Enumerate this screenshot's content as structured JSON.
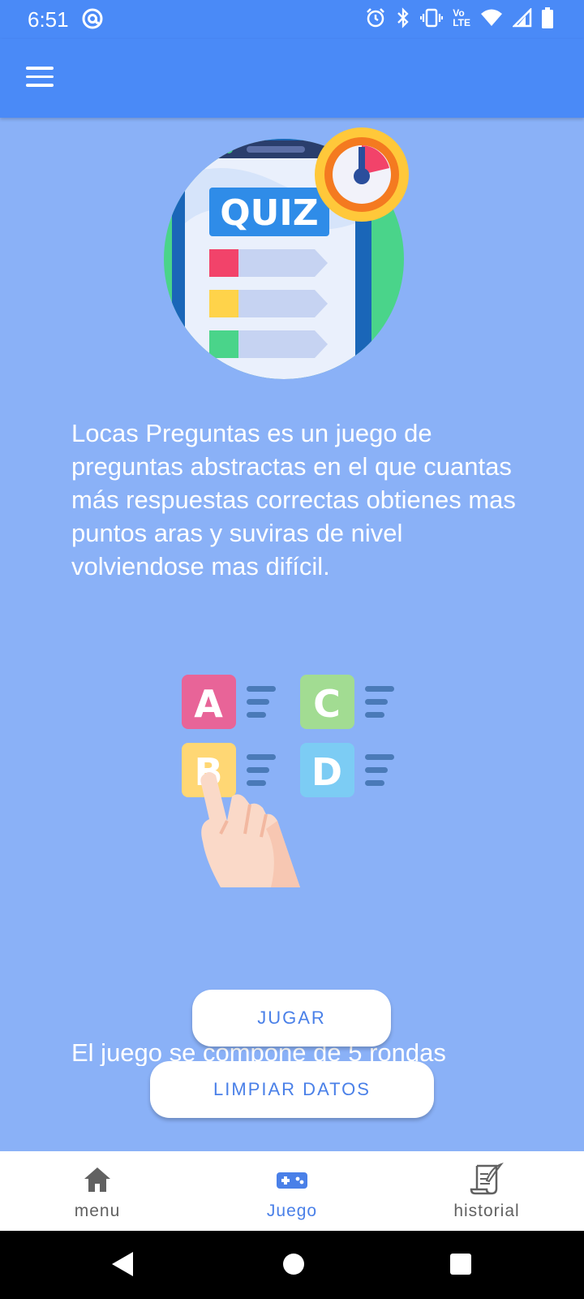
{
  "status_bar": {
    "time": "6:51",
    "icons": [
      "at-sign-icon",
      "alarm-icon",
      "bluetooth-icon",
      "vibrate-icon",
      "volte-icon",
      "wifi-icon",
      "signal-icon",
      "battery-icon"
    ],
    "volte_label_top": "Vo",
    "volte_label_bottom": "LTE"
  },
  "app_bar": {
    "menu_icon": "menu-icon",
    "color": "#4A8AF7"
  },
  "main": {
    "quiz_image_text": "QUIZ",
    "description": "Locas Preguntas es un juego de preguntas abstractas en el que cuantas más respuestas correctas obtienes mas puntos aras y suviras de nivel volviendose mas difícil.",
    "options_letters": [
      "A",
      "B",
      "C",
      "D"
    ],
    "rounds_text": "El juego se compone de 5 rondas",
    "background": "#8AB1F7"
  },
  "buttons": {
    "play_label": "JUGAR",
    "clear_label": "LIMPIAR DATOS"
  },
  "bottom_nav": {
    "items": [
      {
        "label": "menu",
        "icon": "home-icon",
        "active": false
      },
      {
        "label": "Juego",
        "icon": "gamepad-icon",
        "active": true
      },
      {
        "label": "historial",
        "icon": "scroll-quill-icon",
        "active": false
      }
    ],
    "active_color": "#4A80E8"
  },
  "system_nav": {
    "buttons": [
      "back-icon",
      "home-circle-icon",
      "recents-icon"
    ]
  }
}
